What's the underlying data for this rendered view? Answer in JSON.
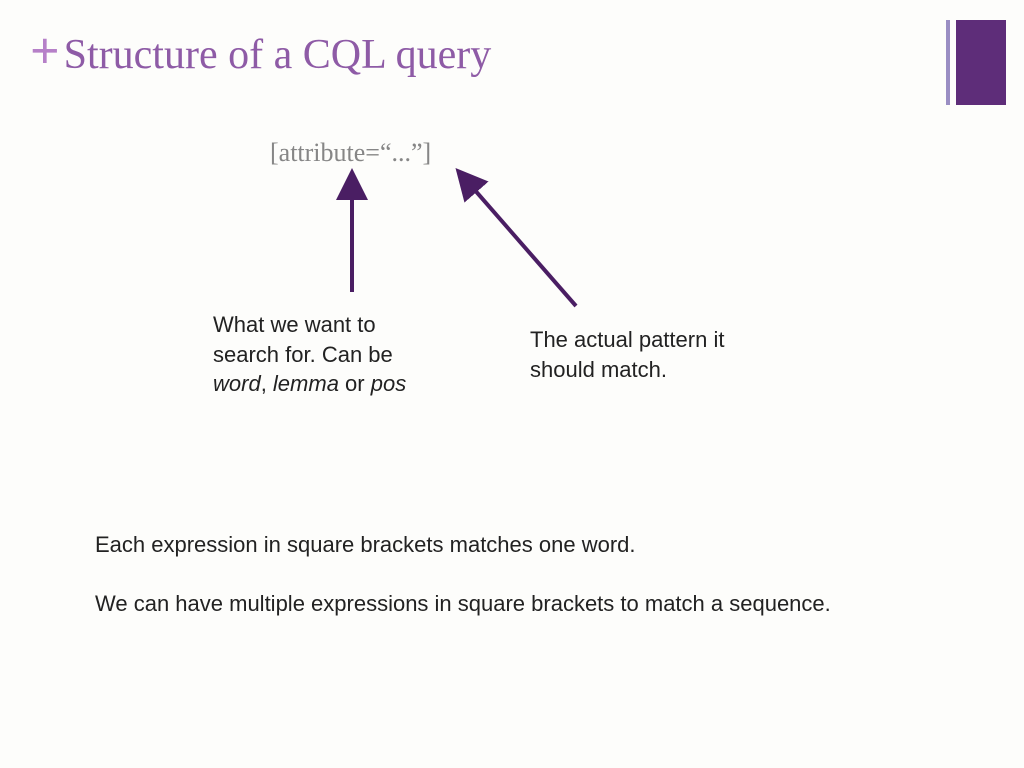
{
  "title": "Structure of a CQL query",
  "plus": "+",
  "syntax": "[attribute=“...”]",
  "left": {
    "line1": "What we want to",
    "line2": "search for. Can be",
    "i1": "word",
    "sep1": ", ",
    "i2": "lemma",
    "sep2": " or ",
    "i3": "pos"
  },
  "right": {
    "line1": "The actual pattern it",
    "line2": "should match."
  },
  "body": {
    "p1": "Each expression in square brackets matches one word.",
    "p2": "We can have multiple expressions in square brackets to match a sequence."
  },
  "colors": {
    "accent": "#5e2d79",
    "title": "#8e5ba6",
    "plus": "#b680c8"
  }
}
